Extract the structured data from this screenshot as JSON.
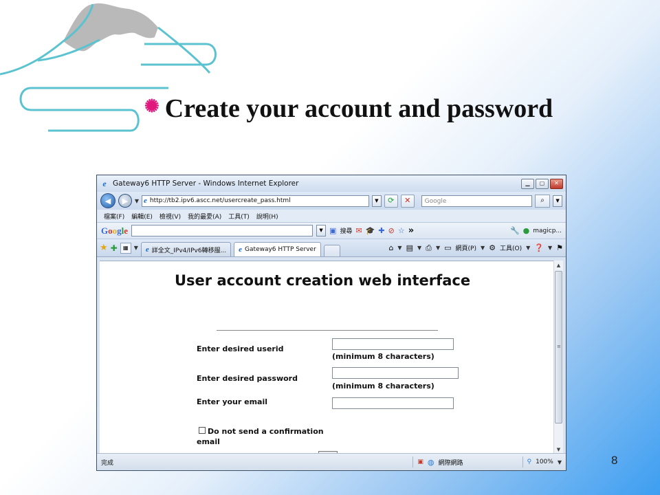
{
  "slide": {
    "bullet": "✺",
    "title": "Create your account and password",
    "page_number": "8"
  },
  "browser": {
    "window_title": "Gateway6 HTTP Server - Windows Internet Explorer",
    "address_url": "http://tb2.ipv6.ascc.net/usercreate_pass.html",
    "search_placeholder": "Google",
    "menu": [
      "檔案(F)",
      "編輯(E)",
      "檢視(V)",
      "我的最愛(A)",
      "工具(T)",
      "說明(H)"
    ],
    "google_toolbar": {
      "search_label": "搜尋",
      "more": "»",
      "account": "magicp..."
    },
    "tabs": [
      {
        "label": "詳全文_IPv4/IPv6轉移服..."
      },
      {
        "label": "Gateway6 HTTP Server"
      }
    ],
    "command_bar": {
      "page_label": "網頁(P)",
      "tools_label": "工具(O)"
    },
    "status": {
      "left": "完成",
      "zone": "網際網路",
      "zoom": "100%"
    }
  },
  "form": {
    "heading": "User account creation web interface",
    "userid_label": "Enter desired userid",
    "userid_hint": "(minimum 8 characters)",
    "userid_value": "",
    "password_label": "Enter desired password",
    "password_hint": "(minimum 8 characters)",
    "password_value": "",
    "email_label": "Enter your email",
    "email_value": "",
    "no_confirm_label": "Do not send a confirmation",
    "no_confirm_label_cont": "email",
    "no_confirm_checked": false
  },
  "colors": {
    "bullet": "#e0177d",
    "accent_blue": "#3d9ef1",
    "deco_line": "#5bc3cf",
    "mountain": "#b9b9b9"
  }
}
